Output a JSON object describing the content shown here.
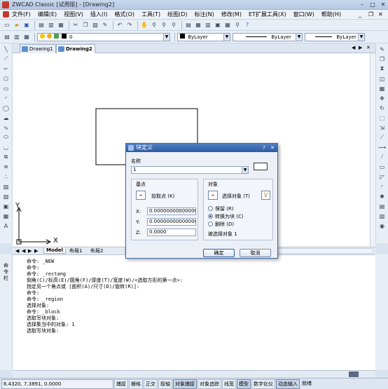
{
  "window": {
    "title": "ZWCAD Classic [试用版] - [Drawing2]",
    "min": "–",
    "max": "□",
    "close": "✕",
    "mdi_min": "_",
    "mdi_max": "❐",
    "mdi_close": "✕"
  },
  "menu": [
    "文件(F)",
    "编辑(E)",
    "视图(V)",
    "插入(I)",
    "格式(O)",
    "工具(T)",
    "绘图(D)",
    "标注(N)",
    "修改(M)",
    "ET扩展工具(X)",
    "窗口(W)",
    "帮助(H)"
  ],
  "properties_bar": {
    "layer_value": "0",
    "color": "ByLayer",
    "linetype": "ByLayer",
    "lineweight": "ByLayer"
  },
  "doc_tabs": [
    "Drawing1",
    "Drawing2"
  ],
  "layout_tabs": [
    "Model",
    "布局1",
    "布局2"
  ],
  "nav_arrows": [
    "◀",
    "◀",
    "▶",
    "▶"
  ],
  "ucs": {
    "y_label": "Y",
    "x_label": "X"
  },
  "command_panel_label": "命令栏",
  "command_lines": [
    "命令: _NEW",
    "命令:",
    "命令: _rectang",
    "倒角(C)/标高(E)/圆角(F)/厚度(T)/宽度(W)/<选取方形的第一点>:",
    "指定另一个角点或 [面积(A)/尺寸(D)/旋转(R)]:",
    "命令:",
    "命令: _region",
    "选择对象:",
    "命令: _block",
    "选取写块对象:",
    "选择集当中的对象: 1",
    "选取写块对象:"
  ],
  "status": {
    "coords": "6.4320, 7.3891, 0.0000",
    "buttons": [
      {
        "label": "捕捉",
        "on": false
      },
      {
        "label": "栅格",
        "on": false
      },
      {
        "label": "正交",
        "on": false
      },
      {
        "label": "极轴",
        "on": false
      },
      {
        "label": "对象捕捉",
        "on": true
      },
      {
        "label": "对象追踪",
        "on": false
      },
      {
        "label": "线宽",
        "on": false
      },
      {
        "label": "模型",
        "on": true
      },
      {
        "label": "数字化仪",
        "on": false
      },
      {
        "label": "动态输入",
        "on": true
      },
      {
        "label": "就绪",
        "on": false
      }
    ]
  },
  "dialog": {
    "title": "块定义",
    "help": "?",
    "close": "✕",
    "name_label": "名称",
    "name_value": "1",
    "base_point": {
      "group_label": "基点",
      "pick_label": "拾取点 (K)",
      "x_label": "X:",
      "x_value": "0.000000000000000",
      "y_label": "Y:",
      "y_value": "0.000000000000000",
      "z_label": "Z:",
      "z_value": "0.0000"
    },
    "objects": {
      "group_label": "对象",
      "select_label": "选择对象 (T)",
      "filter_icon_label": "ⴸ",
      "options": [
        {
          "label": "保留 (R)",
          "selected": false
        },
        {
          "label": "转换为块 (C)",
          "selected": true
        },
        {
          "label": "删除 (D)",
          "selected": false
        }
      ],
      "count_text": "被选择对象 1"
    },
    "ok": "确定",
    "cancel": "取消"
  },
  "colors": {
    "titlebar": "#b4c8e2",
    "dialog_title": "#2d5aa2",
    "canvas": "#ffffff"
  }
}
